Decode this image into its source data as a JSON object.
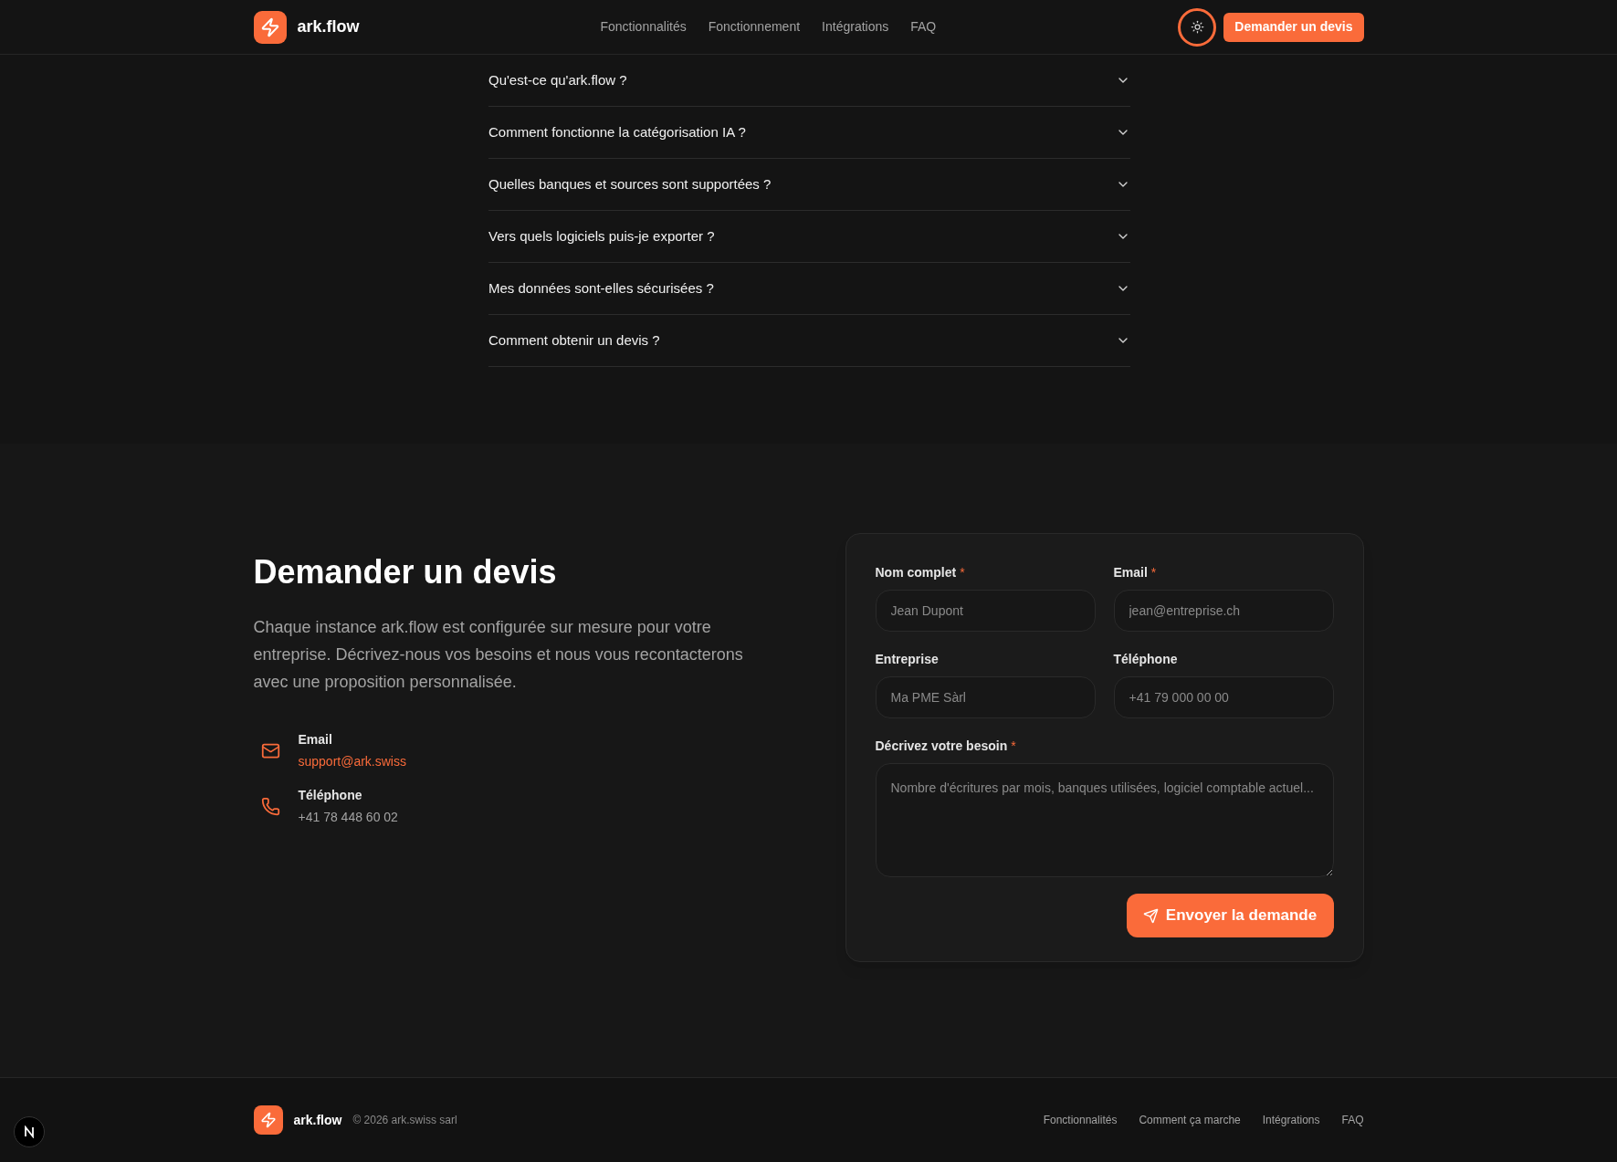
{
  "header": {
    "logo_text": "ark.flow",
    "nav": [
      "Fonctionnalités",
      "Fonctionnement",
      "Intégrations",
      "FAQ"
    ],
    "theme_toggle": {
      "focused": true
    },
    "cta": "Demander un devis"
  },
  "faq": {
    "items": [
      {
        "question": "Qu'est-ce qu'ark.flow ?",
        "expanded": false
      },
      {
        "question": "Comment fonctionne la catégorisation IA ?",
        "expanded": false
      },
      {
        "question": "Quelles banques et sources sont supportées ?",
        "expanded": false
      },
      {
        "question": "Vers quels logiciels puis-je exporter ?",
        "expanded": false
      },
      {
        "question": "Mes données sont-elles sécurisées ?",
        "expanded": false
      },
      {
        "question": "Comment obtenir un devis ?",
        "expanded": false
      }
    ]
  },
  "contact": {
    "title": "Demander un devis",
    "description": "Chaque instance ark.flow est configurée sur mesure pour votre entreprise. Décrivez-nous vos besoins et nous vous recontacterons avec une proposition personnalisée.",
    "items": [
      {
        "kind": "email",
        "label": "Email",
        "value": "support@ark.swiss"
      },
      {
        "kind": "phone",
        "label": "Téléphone",
        "value": "+41 78 448 60 02"
      }
    ]
  },
  "form": {
    "required_mark": "*",
    "fields": [
      {
        "kind": "input",
        "label": "Nom complet",
        "required": true,
        "placeholder": "Jean Dupont"
      },
      {
        "kind": "input",
        "label": "Email",
        "required": true,
        "placeholder": "jean@entreprise.ch"
      },
      {
        "kind": "input",
        "label": "Entreprise",
        "required": false,
        "placeholder": "Ma PME Sàrl"
      },
      {
        "kind": "input",
        "label": "Téléphone",
        "required": false,
        "placeholder": "+41 79 000 00 00"
      },
      {
        "kind": "textarea",
        "label": "Décrivez votre besoin",
        "required": true,
        "placeholder": "Nombre d'écritures par mois, banques utilisées, logiciel comptable actuel..."
      }
    ],
    "submit": "Envoyer la demande"
  },
  "footer": {
    "logo_text": "ark.flow",
    "copyright": "© 2026 ark.swiss sarl",
    "links": [
      "Fonctionnalités",
      "Comment ça marche",
      "Intégrations",
      "FAQ"
    ]
  }
}
